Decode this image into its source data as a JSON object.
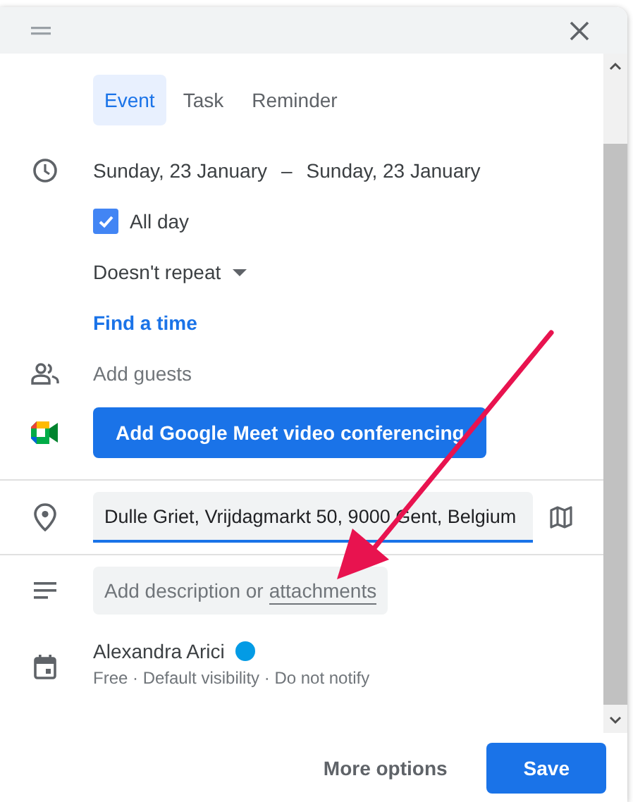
{
  "tabs": [
    {
      "label": "Event",
      "selected": true
    },
    {
      "label": "Task",
      "selected": false
    },
    {
      "label": "Reminder",
      "selected": false
    }
  ],
  "date_range": {
    "start": "Sunday, 23 January",
    "separator": "–",
    "end": "Sunday, 23 January"
  },
  "all_day": {
    "label": "All day",
    "checked": true
  },
  "repeat": {
    "label": "Doesn't repeat"
  },
  "find_time": "Find a time",
  "guests": {
    "placeholder": "Add guests"
  },
  "meet_button": "Add Google Meet video conferencing",
  "location": {
    "value": "Dulle Griet, Vrijdagmarkt 50, 9000 Gent, Belgium"
  },
  "description": {
    "text": "Add description or",
    "link": "attachments"
  },
  "calendar": {
    "owner": "Alexandra Arici",
    "color": "#039be5",
    "details": "Free · Default visibility · Do not notify"
  },
  "buttons": [
    {
      "label": "More options",
      "kind": "text"
    },
    {
      "label": "Save",
      "kind": "primary"
    }
  ]
}
